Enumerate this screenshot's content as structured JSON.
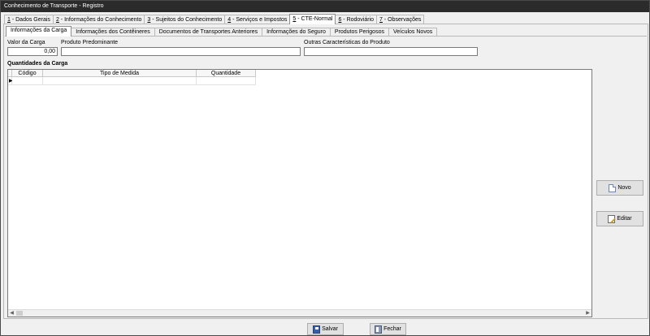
{
  "window": {
    "title": "Conhecimento de Transporte - Registro"
  },
  "main_tabs": [
    {
      "hotkey": "1",
      "label": " - Dados Gerais"
    },
    {
      "hotkey": "2",
      "label": " - Informações do Conhecimento"
    },
    {
      "hotkey": "3",
      "label": " - Sujeitos do Conhecimento"
    },
    {
      "hotkey": "4",
      "label": " - Serviços e Impostos"
    },
    {
      "hotkey": "5",
      "label": " - CTE-Normal"
    },
    {
      "hotkey": "6",
      "label": " - Rodoviário"
    },
    {
      "hotkey": "7",
      "label": " - Observações"
    }
  ],
  "sub_tabs": [
    "Informações da Carga",
    "Informações dos Contêineres",
    "Documentos de Transportes Anteriores",
    "Informações do Seguro",
    "Produtos Perigosos",
    "Veículos Novos"
  ],
  "cargo": {
    "valor_label": "Valor da Carga",
    "valor_value": "0,00",
    "produto_label": "Produto Predominante",
    "produto_value": "",
    "outras_label": "Outras Características do Produto",
    "outras_value": ""
  },
  "quantities": {
    "title": "Quantidades da Carga",
    "columns": [
      "Código",
      "Tipo de Medida",
      "Quantidade"
    ],
    "row_indicator": "▶"
  },
  "actions": {
    "novo": "Novo",
    "editar": "Editar"
  },
  "footer": {
    "salvar": "Salvar",
    "fechar": "Fechar"
  }
}
